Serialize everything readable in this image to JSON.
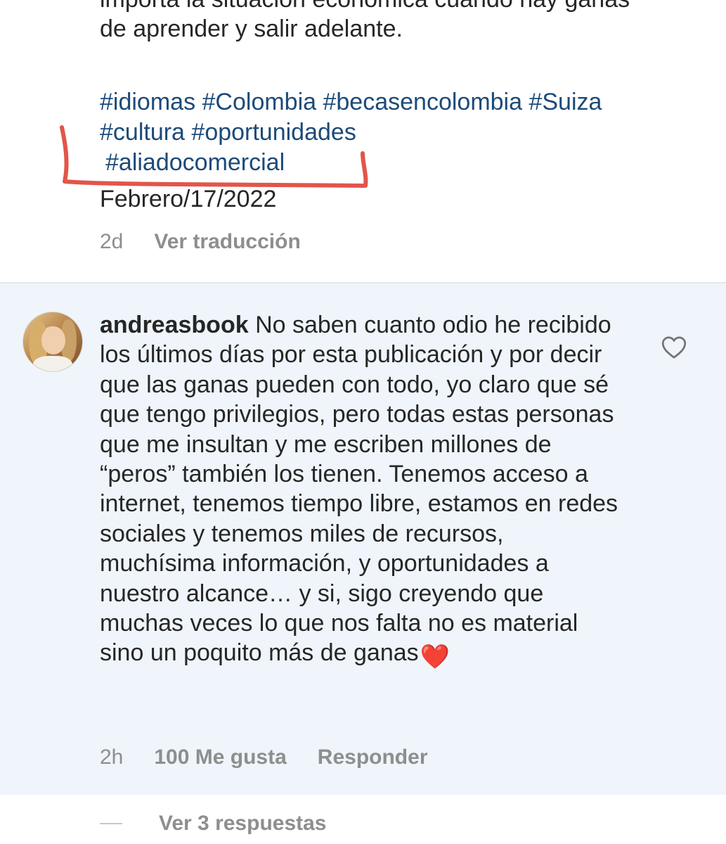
{
  "caption": {
    "text_lines": [
      "importa la situación económica cuando hay ganas",
      "de aprender y salir adelante."
    ],
    "hashtags_line1": "#idiomas #Colombia #becasencolombia #Suiza",
    "hashtags_line2": "#cultura #oportunidades",
    "hashtags_line3": "#aliadocomercial",
    "date": "Febrero/17/2022",
    "age": "2d",
    "translate_label": "Ver traducción"
  },
  "annotation": {
    "color": "#e0463a"
  },
  "comment": {
    "username": "andreasbook",
    "text": "No saben cuanto odio he recibido los últimos días por esta publicación y por decir que las ganas pueden con todo, yo claro que sé que tengo privilegios, pero todas estas personas que me insultan y me escriben millones de “peros” también los tienen. Tenemos acceso a internet, tenemos tiempo libre, estamos en redes sociales y tenemos miles de recursos, muchísima información, y oportunidades a nuestro alcance… y si, sigo creyendo que muchas veces lo que nos falta no es material sino un poquito más de ganas",
    "emoji": "❤️",
    "age": "2h",
    "likes_label": "100 Me gusta",
    "reply_label": "Responder",
    "like_icon": "heart-outline-icon",
    "background_color": "#eff5fa"
  },
  "replies": {
    "label": "Ver 3 respuestas"
  },
  "colors": {
    "text": "#262626",
    "muted": "#8e8e8e",
    "hashtag": "#1c4a78"
  }
}
